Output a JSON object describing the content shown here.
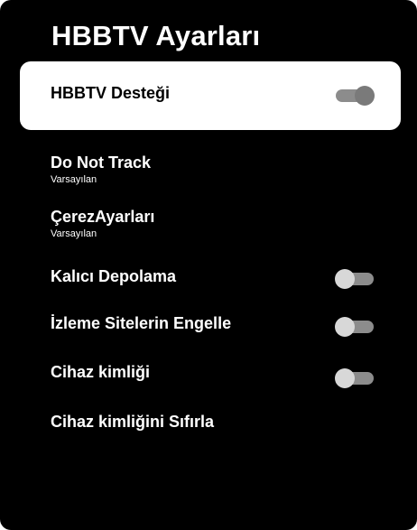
{
  "page": {
    "title": "HBBTV Ayarları"
  },
  "menu": {
    "items": [
      {
        "label": "HBBTV Desteği",
        "toggle": "on",
        "selected": true
      },
      {
        "label": "Do Not Track",
        "sublabel": "Varsayılan"
      },
      {
        "label": "ÇerezAyarları",
        "sublabel": "Varsayılan"
      },
      {
        "label": "Kalıcı Depolama",
        "toggle": "off"
      },
      {
        "label": "İzleme Sitelerin Engelle",
        "toggle": "off"
      },
      {
        "label": "Cihaz kimliği",
        "toggle": "off"
      },
      {
        "label": "Cihaz kimliğini Sıfırla"
      }
    ]
  },
  "colors": {
    "background": "#000000",
    "text": "#ffffff",
    "selected_background": "#ffffff",
    "toggle_track": "#8c8c8c"
  }
}
